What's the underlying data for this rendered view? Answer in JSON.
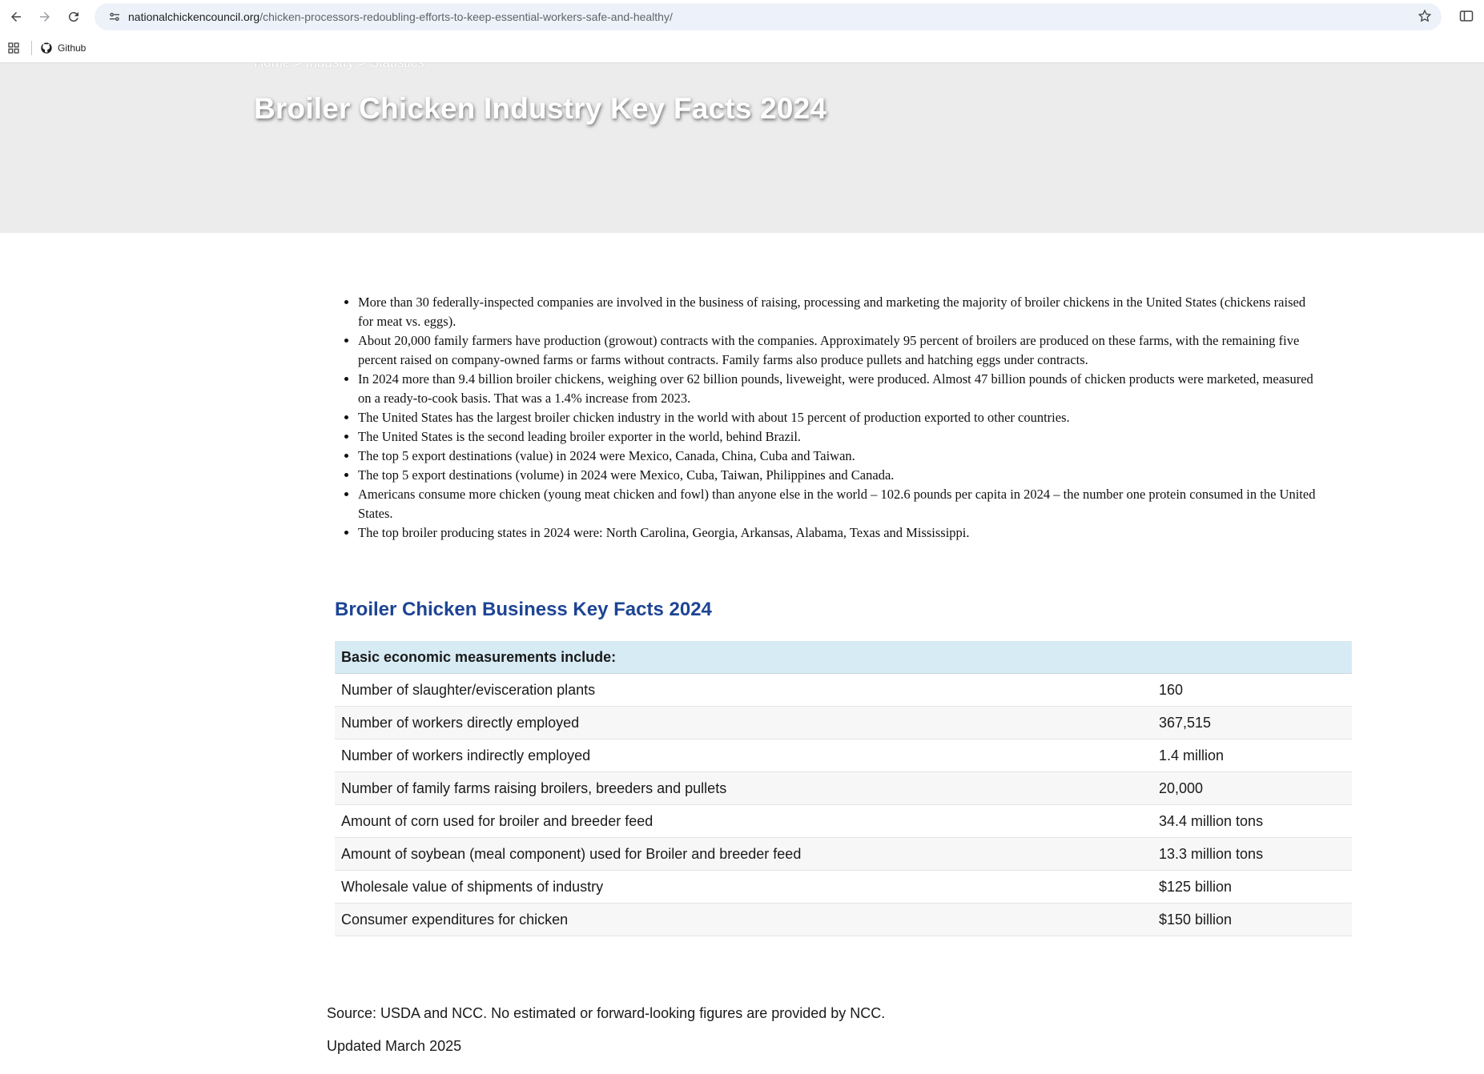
{
  "browser": {
    "url_domain": "nationalchickencouncil.org",
    "url_path": "/chicken-processors-redoubling-efforts-to-keep-essential-workers-safe-and-healthy/",
    "bookmark_github": "Github"
  },
  "hero": {
    "breadcrumb": "Home > Industry > Statistics",
    "title": "Broiler Chicken Industry Key Facts 2024"
  },
  "facts": [
    "More than 30 federally-inspected companies are involved in the business of raising, processing and marketing the majority of broiler chickens in the United States (chickens raised for meat vs. eggs).",
    "About 20,000 family farmers have production (growout) contracts with the companies.  Approximately 95 percent of broilers are produced on these farms, with the remaining five percent raised on company-owned farms or farms without contracts. Family farms also produce pullets and hatching eggs under contracts.",
    "In 2024 more than 9.4 billion broiler chickens, weighing over 62 billion pounds, liveweight, were produced. Almost 47 billion pounds of chicken products were marketed, measured on a ready-to-cook basis. That was a 1.4% increase from 2023.",
    "The United States has the largest broiler chicken industry in the world with about 15 percent of production exported to other countries.",
    "The United States is the second leading broiler exporter in the world, behind Brazil.",
    "The top 5 export destinations (value) in 2024 were Mexico, Canada, China, Cuba and Taiwan.",
    "The top 5 export destinations (volume) in 2024 were Mexico, Cuba, Taiwan, Philippines and Canada.",
    "Americans consume more chicken (young meat chicken and fowl) than anyone else in the world – 102.6 pounds per capita in 2024 – the number one protein consumed in the United States.",
    "The top broiler producing states in 2024 were: North Carolina, Georgia, Arkansas, Alabama, Texas and Mississippi."
  ],
  "business": {
    "title": "Broiler Chicken Business Key Facts 2024",
    "table_header": "Basic economic measurements include:",
    "rows": [
      {
        "label": "Number of slaughter/evisceration plants",
        "value": "160"
      },
      {
        "label": "Number of workers directly employed",
        "value": "367,515"
      },
      {
        "label": "Number of workers indirectly employed",
        "value": "1.4 million"
      },
      {
        "label": "Number of family farms raising broilers, breeders and pullets",
        "value": "20,000"
      },
      {
        "label": "Amount of corn used for broiler and breeder feed",
        "value": "34.4 million tons"
      },
      {
        "label": "Amount of soybean (meal component) used for Broiler and breeder feed",
        "value": "13.3 million tons"
      },
      {
        "label": "Wholesale value of shipments of industry",
        "value": "$125 billion"
      },
      {
        "label": "Consumer expenditures for chicken",
        "value": "$150 billion"
      }
    ]
  },
  "footer": {
    "source": "Source: USDA and NCC. No estimated or forward-looking figures are provided by NCC.",
    "updated": "Updated March 2025"
  }
}
